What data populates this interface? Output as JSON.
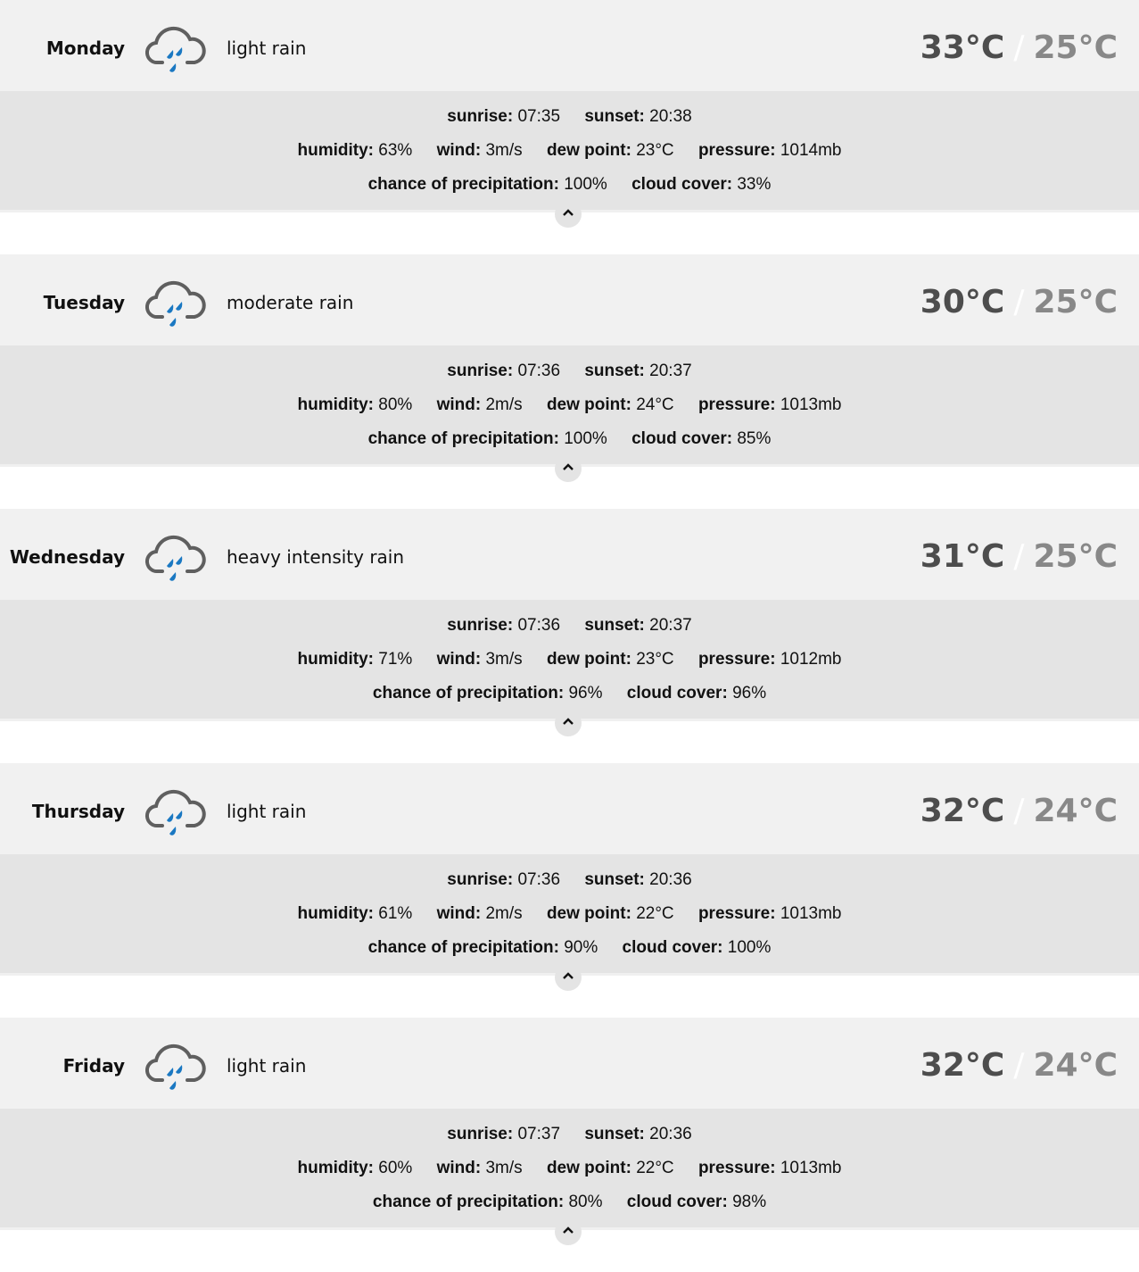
{
  "labels": {
    "sunrise": "sunrise:",
    "sunset": "sunset:",
    "humidity": "humidity:",
    "wind": "wind:",
    "dew_point": "dew point:",
    "pressure": "pressure:",
    "precipitation": "chance of precipitation:",
    "cloud_cover": "cloud cover:",
    "temp_separator": "/"
  },
  "icons": {
    "weather": "cloud-rain-icon",
    "collapse": "chevron-up-icon"
  },
  "colors": {
    "rain_drops": "#1a78c2",
    "cloud": "#5f5f5f",
    "high_temp": "#4d4d4d",
    "low_temp": "#888888"
  },
  "days": [
    {
      "name": "Monday",
      "description": "light rain",
      "high": "33°C",
      "low": "25°C",
      "sunrise": "07:35",
      "sunset": "20:38",
      "humidity": "63%",
      "wind": "3m/s",
      "dew_point": "23°C",
      "pressure": "1014mb",
      "precipitation": "100%",
      "cloud_cover": "33%"
    },
    {
      "name": "Tuesday",
      "description": "moderate rain",
      "high": "30°C",
      "low": "25°C",
      "sunrise": "07:36",
      "sunset": "20:37",
      "humidity": "80%",
      "wind": "2m/s",
      "dew_point": "24°C",
      "pressure": "1013mb",
      "precipitation": "100%",
      "cloud_cover": "85%"
    },
    {
      "name": "Wednesday",
      "description": "heavy intensity rain",
      "high": "31°C",
      "low": "25°C",
      "sunrise": "07:36",
      "sunset": "20:37",
      "humidity": "71%",
      "wind": "3m/s",
      "dew_point": "23°C",
      "pressure": "1012mb",
      "precipitation": "96%",
      "cloud_cover": "96%"
    },
    {
      "name": "Thursday",
      "description": "light rain",
      "high": "32°C",
      "low": "24°C",
      "sunrise": "07:36",
      "sunset": "20:36",
      "humidity": "61%",
      "wind": "2m/s",
      "dew_point": "22°C",
      "pressure": "1013mb",
      "precipitation": "90%",
      "cloud_cover": "100%"
    },
    {
      "name": "Friday",
      "description": "light rain",
      "high": "32°C",
      "low": "24°C",
      "sunrise": "07:37",
      "sunset": "20:36",
      "humidity": "60%",
      "wind": "3m/s",
      "dew_point": "22°C",
      "pressure": "1013mb",
      "precipitation": "80%",
      "cloud_cover": "98%"
    }
  ]
}
